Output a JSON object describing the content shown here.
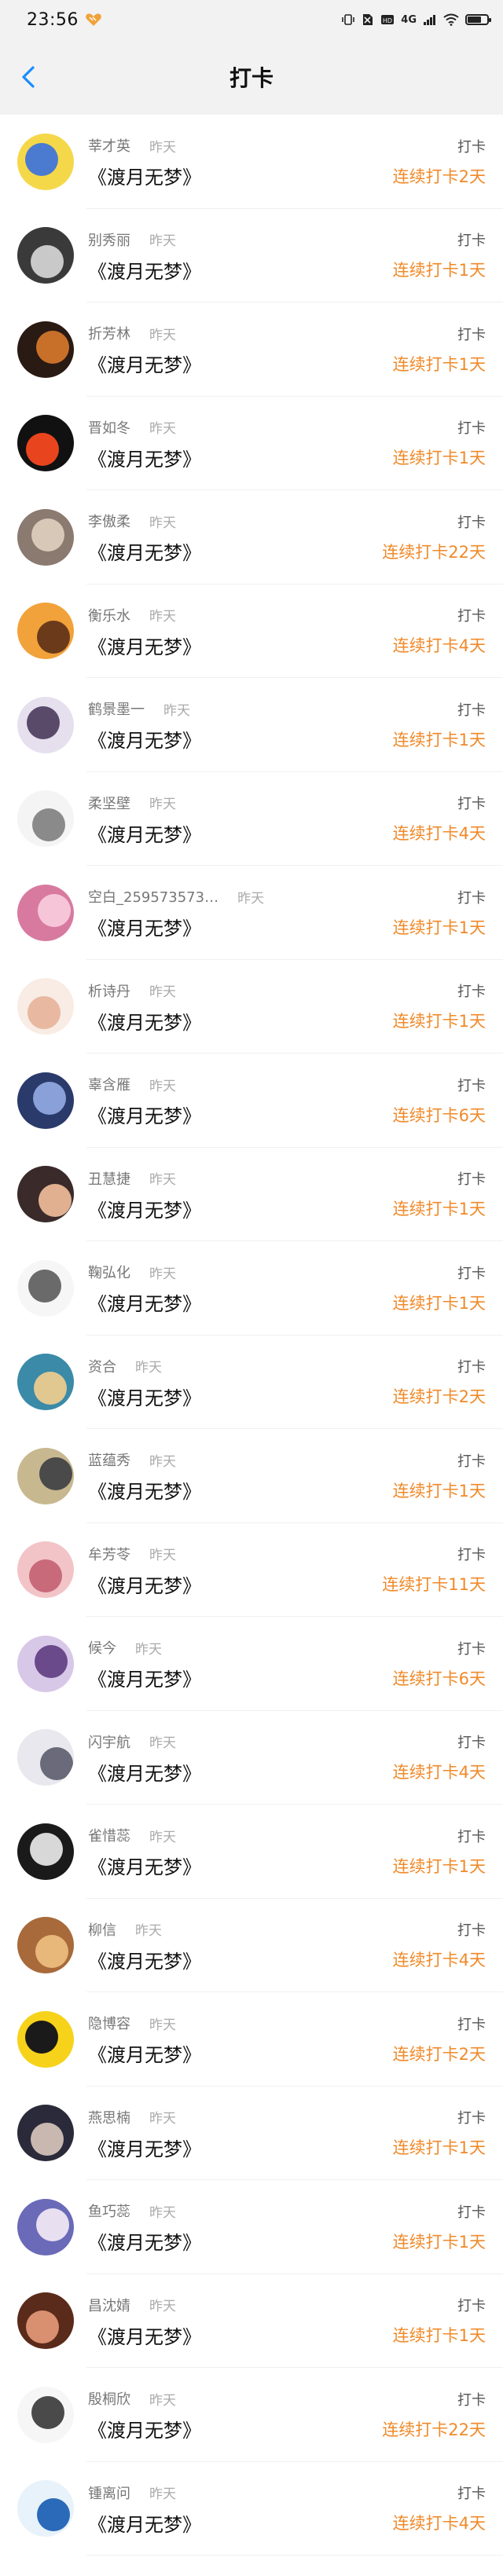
{
  "status_bar": {
    "time": "23:56",
    "network_label": "4G",
    "battery_level": 0.75
  },
  "nav": {
    "title": "打卡",
    "back_icon": "chevron-left-icon"
  },
  "colors": {
    "accent": "#1a8cff",
    "streak": "#f08a2a",
    "background": "#ffffff",
    "bar_background": "#f2f2f2"
  },
  "rows": [
    {
      "user": "莘才英",
      "when": "昨天",
      "book": "《渡月无梦》",
      "action": "打卡",
      "streak": "连续打卡2天",
      "avatar": [
        "#f5d84a",
        "#4a7bd1"
      ]
    },
    {
      "user": "别秀丽",
      "when": "昨天",
      "book": "《渡月无梦》",
      "action": "打卡",
      "streak": "连续打卡1天",
      "avatar": [
        "#3a3a3a",
        "#c9c9c9"
      ]
    },
    {
      "user": "折芳林",
      "when": "昨天",
      "book": "《渡月无梦》",
      "action": "打卡",
      "streak": "连续打卡1天",
      "avatar": [
        "#2a1a14",
        "#c8702a"
      ]
    },
    {
      "user": "晋如冬",
      "when": "昨天",
      "book": "《渡月无梦》",
      "action": "打卡",
      "streak": "连续打卡1天",
      "avatar": [
        "#111111",
        "#e8451e"
      ]
    },
    {
      "user": "李傲柔",
      "when": "昨天",
      "book": "《渡月无梦》",
      "action": "打卡",
      "streak": "连续打卡22天",
      "avatar": [
        "#8a7a70",
        "#d8c8b8"
      ]
    },
    {
      "user": "衡乐水",
      "when": "昨天",
      "book": "《渡月无梦》",
      "action": "打卡",
      "streak": "连续打卡4天",
      "avatar": [
        "#f2a23a",
        "#6a3a1a"
      ]
    },
    {
      "user": "鹤景墨一",
      "when": "昨天",
      "book": "《渡月无梦》",
      "action": "打卡",
      "streak": "连续打卡1天",
      "avatar": [
        "#e6e0ee",
        "#5a4a6a"
      ]
    },
    {
      "user": "柔坚壁",
      "when": "昨天",
      "book": "《渡月无梦》",
      "action": "打卡",
      "streak": "连续打卡4天",
      "avatar": [
        "#f4f4f4",
        "#8a8a8a"
      ]
    },
    {
      "user": "空白_259573573…",
      "when": "昨天",
      "book": "《渡月无梦》",
      "action": "打卡",
      "streak": "连续打卡1天",
      "avatar": [
        "#d87aa0",
        "#f6c6d8"
      ]
    },
    {
      "user": "析诗丹",
      "when": "昨天",
      "book": "《渡月无梦》",
      "action": "打卡",
      "streak": "连续打卡1天",
      "avatar": [
        "#f8ece4",
        "#e8b8a0"
      ]
    },
    {
      "user": "辜含雁",
      "when": "昨天",
      "book": "《渡月无梦》",
      "action": "打卡",
      "streak": "连续打卡6天",
      "avatar": [
        "#2a3a6a",
        "#8aa0d8"
      ]
    },
    {
      "user": "丑慧捷",
      "when": "昨天",
      "book": "《渡月无梦》",
      "action": "打卡",
      "streak": "连续打卡1天",
      "avatar": [
        "#3a2a2a",
        "#e0b090"
      ]
    },
    {
      "user": "鞠弘化",
      "when": "昨天",
      "book": "《渡月无梦》",
      "action": "打卡",
      "streak": "连续打卡1天",
      "avatar": [
        "#f6f6f6",
        "#6a6a6a"
      ]
    },
    {
      "user": "资合",
      "when": "昨天",
      "book": "《渡月无梦》",
      "action": "打卡",
      "streak": "连续打卡2天",
      "avatar": [
        "#3a8aa8",
        "#e0c890"
      ]
    },
    {
      "user": "蓝蕴秀",
      "when": "昨天",
      "book": "《渡月无梦》",
      "action": "打卡",
      "streak": "连续打卡1天",
      "avatar": [
        "#c8b890",
        "#4a4a4a"
      ]
    },
    {
      "user": "牟芳苓",
      "when": "昨天",
      "book": "《渡月无梦》",
      "action": "打卡",
      "streak": "连续打卡11天",
      "avatar": [
        "#f2c4c8",
        "#c86a7a"
      ]
    },
    {
      "user": "候今",
      "when": "昨天",
      "book": "《渡月无梦》",
      "action": "打卡",
      "streak": "连续打卡6天",
      "avatar": [
        "#d8c8e8",
        "#6a4a8a"
      ]
    },
    {
      "user": "闪宇航",
      "when": "昨天",
      "book": "《渡月无梦》",
      "action": "打卡",
      "streak": "连续打卡4天",
      "avatar": [
        "#e8e8ee",
        "#6a6a7a"
      ]
    },
    {
      "user": "雀惜蕊",
      "when": "昨天",
      "book": "《渡月无梦》",
      "action": "打卡",
      "streak": "连续打卡1天",
      "avatar": [
        "#1a1a1a",
        "#d8d8d8"
      ]
    },
    {
      "user": "柳信",
      "when": "昨天",
      "book": "《渡月无梦》",
      "action": "打卡",
      "streak": "连续打卡4天",
      "avatar": [
        "#a86a3a",
        "#e8b87a"
      ]
    },
    {
      "user": "隐博容",
      "when": "昨天",
      "book": "《渡月无梦》",
      "action": "打卡",
      "streak": "连续打卡2天",
      "avatar": [
        "#f6d21a",
        "#1a1a1a"
      ]
    },
    {
      "user": "燕思楠",
      "when": "昨天",
      "book": "《渡月无梦》",
      "action": "打卡",
      "streak": "连续打卡1天",
      "avatar": [
        "#2a2a3a",
        "#c8b8b0"
      ]
    },
    {
      "user": "鱼巧蕊",
      "when": "昨天",
      "book": "《渡月无梦》",
      "action": "打卡",
      "streak": "连续打卡1天",
      "avatar": [
        "#6a6ab8",
        "#e8e0f0"
      ]
    },
    {
      "user": "昌沈婧",
      "when": "昨天",
      "book": "《渡月无梦》",
      "action": "打卡",
      "streak": "连续打卡1天",
      "avatar": [
        "#5a2a1a",
        "#d89070"
      ]
    },
    {
      "user": "殷桐欣",
      "when": "昨天",
      "book": "《渡月无梦》",
      "action": "打卡",
      "streak": "连续打卡22天",
      "avatar": [
        "#f6f6f6",
        "#4a4a4a"
      ]
    },
    {
      "user": "锺离问",
      "when": "昨天",
      "book": "《渡月无梦》",
      "action": "打卡",
      "streak": "连续打卡4天",
      "avatar": [
        "#e8f2fa",
        "#2a6ab8"
      ]
    }
  ]
}
